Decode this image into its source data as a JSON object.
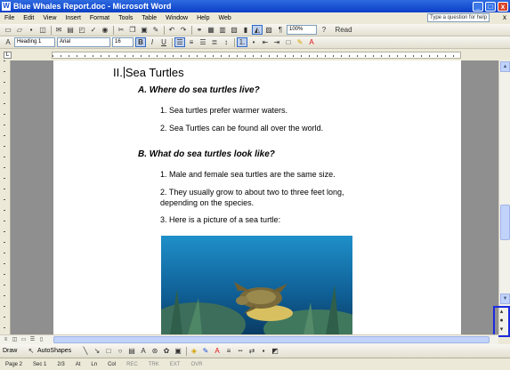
{
  "window": {
    "title": "Blue Whales Report.doc - Microsoft Word",
    "app_icon": "W",
    "buttons": {
      "minimize": "_",
      "maximize": "□",
      "close": "x"
    }
  },
  "menubar": {
    "items": [
      "File",
      "Edit",
      "View",
      "Insert",
      "Format",
      "Tools",
      "Table",
      "Window",
      "Help",
      "Web"
    ],
    "help_box": "Type a question for help",
    "doc_close": "x"
  },
  "toolbar_standard": {
    "zoom": "100%",
    "read_label": "Read"
  },
  "toolbar_formatting": {
    "style": "Heading 1",
    "font": "Arial",
    "size": "16",
    "bold": "B",
    "italic": "I",
    "underline": "U"
  },
  "document": {
    "heading": {
      "number": "II.",
      "text": "Sea Turtles"
    },
    "section_a": {
      "title": "A. Where do sea turtles live?",
      "items": [
        "1.  Sea turtles prefer warmer waters.",
        "2.  Sea Turtles can be found all over the world."
      ]
    },
    "section_b": {
      "title": "B.  What do sea turtles look like?",
      "items": [
        "1.   Male and female sea turtles are the same size.",
        "2.  They usually grow to about two to three feet long,",
        "depending on the species.",
        "3.  Here is a picture of a sea turtle:"
      ]
    }
  },
  "drawbar": {
    "draw_label": "Draw",
    "autoshapes_label": "AutoShapes"
  },
  "statusbar": {
    "page": "Page 2",
    "section": "Sec 1",
    "page_of": "2/3",
    "at": "At",
    "ln": "Ln",
    "col": "Col",
    "modes": [
      "REC",
      "TRK",
      "EXT",
      "OVR"
    ]
  }
}
